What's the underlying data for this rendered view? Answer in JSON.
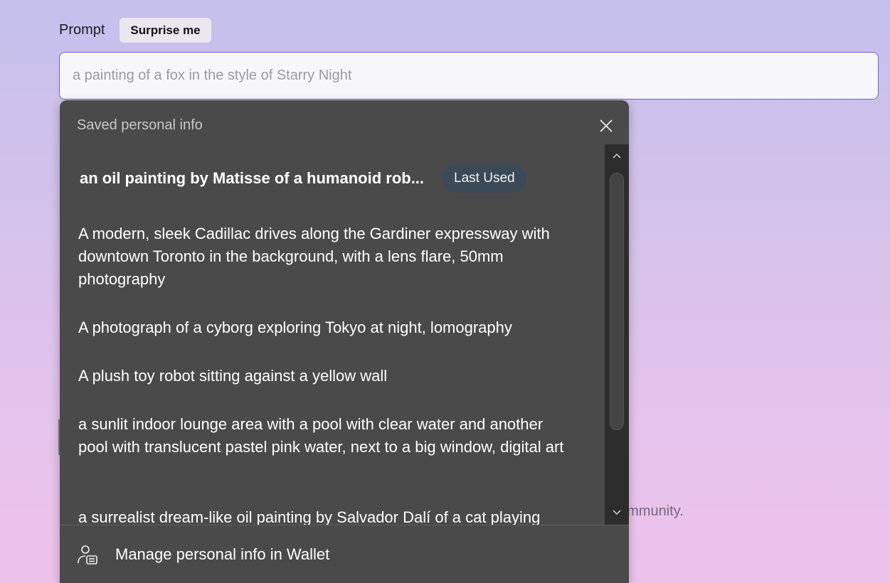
{
  "prompt": {
    "label": "Prompt",
    "surprise_label": "Surprise me",
    "placeholder": "a painting of a fox in the style of Starry Night"
  },
  "background": {
    "partial_text": "ommunity."
  },
  "autofill_popup": {
    "title": "Saved personal info",
    "items": [
      {
        "text": "an oil painting by Matisse of a humanoid rob...",
        "badge": "Last Used"
      },
      {
        "text": "A modern, sleek Cadillac drives along the Gardiner expressway with downtown Toronto in the background, with a lens flare, 50mm photography"
      },
      {
        "text": "A photograph of a cyborg exploring Tokyo at night, lomography"
      },
      {
        "text": "A plush toy robot sitting against a yellow wall"
      },
      {
        "text": "a sunlit indoor lounge area with a pool with clear water and another pool with translucent pastel pink water, next to a big window, digital art"
      },
      {
        "text": "a surrealist dream-like oil painting by Salvador Dalí of a cat playing"
      }
    ],
    "footer_label": "Manage personal info in Wallet"
  },
  "icons": {
    "close": "close-icon",
    "scroll_up": "chevron-up-icon",
    "scroll_down": "chevron-down-icon",
    "wallet": "person-wallet-icon"
  },
  "colors": {
    "popup_bg": "#4a4a4a",
    "badge_bg": "#3c4956",
    "input_border": "#6a5fe0"
  }
}
